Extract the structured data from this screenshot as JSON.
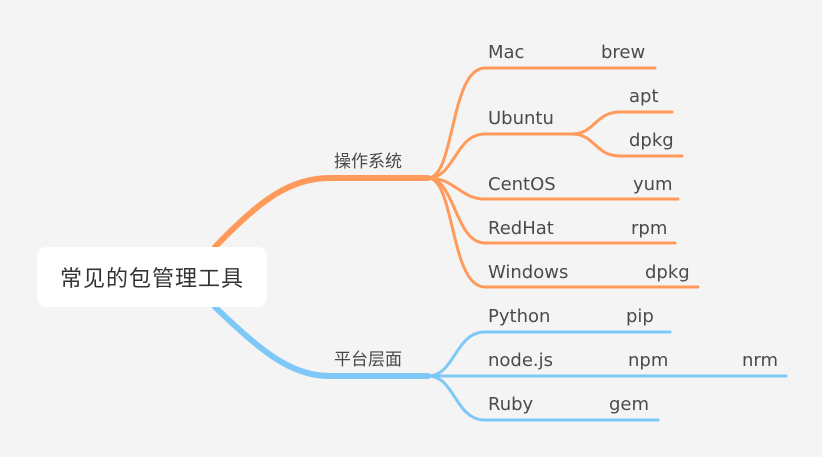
{
  "root": {
    "label": "常见的包管理工具"
  },
  "colors": {
    "os_branch": "#ff9a5a",
    "platform_branch": "#7ec8f7",
    "background": "#f4f4f4",
    "text": "#4a4a4a"
  },
  "os": {
    "label": "操作系统",
    "mac": {
      "label": "Mac",
      "tool": "brew"
    },
    "ubuntu": {
      "label": "Ubuntu",
      "tool1": "apt",
      "tool2": "dpkg"
    },
    "centos": {
      "label": "CentOS",
      "tool": "yum"
    },
    "redhat": {
      "label": "RedHat",
      "tool": "rpm"
    },
    "windows": {
      "label": "Windows",
      "tool": "dpkg"
    }
  },
  "platform": {
    "label": "平台层面",
    "python": {
      "label": "Python",
      "tool": "pip"
    },
    "node": {
      "label": "node.js",
      "tool": "npm",
      "tool2": "nrm"
    },
    "ruby": {
      "label": "Ruby",
      "tool": "gem"
    }
  }
}
